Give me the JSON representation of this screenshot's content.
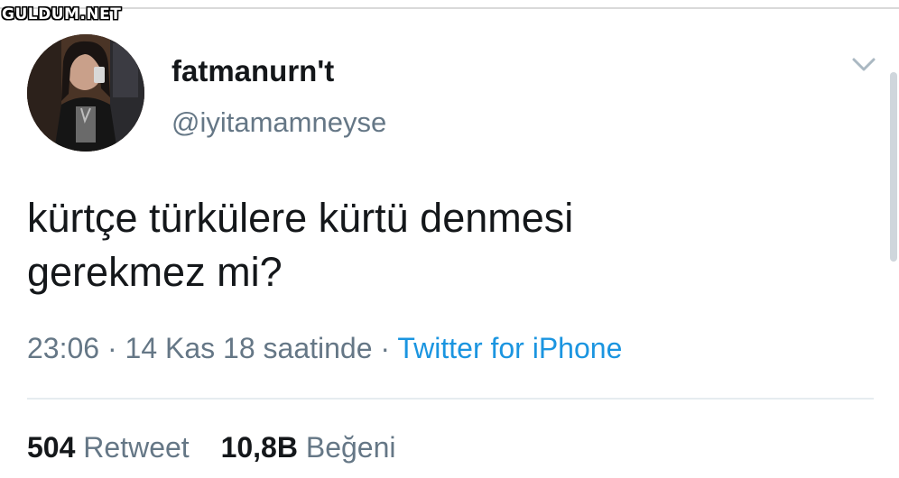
{
  "watermark": {
    "text": "GULDUM.NET"
  },
  "profile": {
    "display_name": "fatmanurn't",
    "handle": "@iyitamamneyse"
  },
  "tweet": {
    "text_line_1": "kürtçe türkülere kürtü denmesi",
    "text_line_2": "gerekmez mi?"
  },
  "meta": {
    "time": "23:06",
    "separator": "·",
    "date": "14 Kas 18 saatinde",
    "source": "Twitter for iPhone"
  },
  "stats": {
    "retweet_count": "504",
    "retweet_label": "Retweet",
    "like_count": "10,8B",
    "like_label": "Beğeni"
  },
  "icons": {
    "menu": "chevron-down-icon"
  },
  "colors": {
    "text_primary": "#14171a",
    "text_secondary": "#657786",
    "link": "#1b95e0",
    "divider": "#e6ecf0"
  }
}
